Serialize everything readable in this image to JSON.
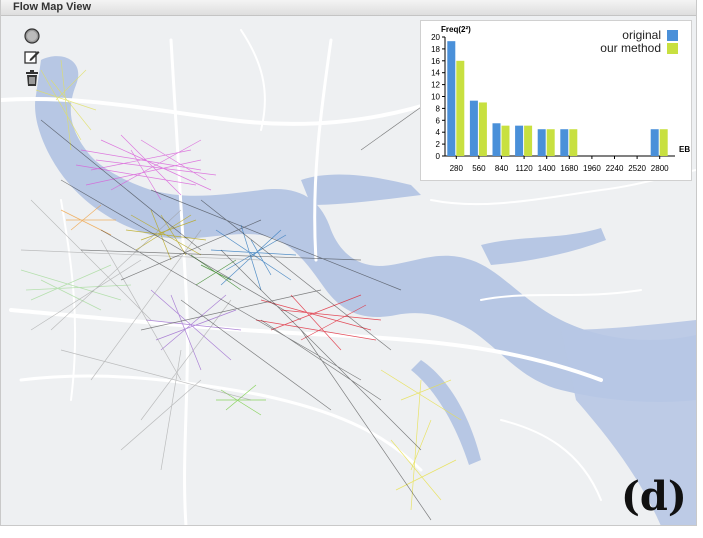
{
  "window": {
    "title": "Flow Map View"
  },
  "toolbar": {
    "tools": [
      {
        "name": "lasso-select-icon"
      },
      {
        "name": "edit-icon"
      },
      {
        "name": "trash-icon"
      }
    ]
  },
  "panel_label": "(d)",
  "colors": {
    "original": "#4a90d9",
    "our_method": "#c8e040",
    "river": "#b7c7e4",
    "land": "#eef0f2",
    "road": "#ffffff"
  },
  "chart_data": {
    "type": "bar",
    "ylabel": "Freq(2²)",
    "xlabel": "EB",
    "ylim": [
      0,
      20
    ],
    "yticks": [
      "0",
      "2",
      "4",
      "6",
      "8",
      "10",
      "12",
      "14",
      "16",
      "18",
      "20"
    ],
    "categories": [
      "280",
      "560",
      "840",
      "1120",
      "1400",
      "1680",
      "1960",
      "2240",
      "2520",
      "2800"
    ],
    "series": [
      {
        "name": "original",
        "color": "#4a90d9",
        "values": [
          19.3,
          9.3,
          5.5,
          5.1,
          4.5,
          4.5,
          0,
          0,
          0,
          4.5
        ]
      },
      {
        "name": "our method",
        "color": "#c8e040",
        "values": [
          16.0,
          9.0,
          5.1,
          5.1,
          4.5,
          4.5,
          0,
          0,
          0,
          4.5
        ]
      }
    ],
    "legend_position": "top-right",
    "grid": false
  }
}
